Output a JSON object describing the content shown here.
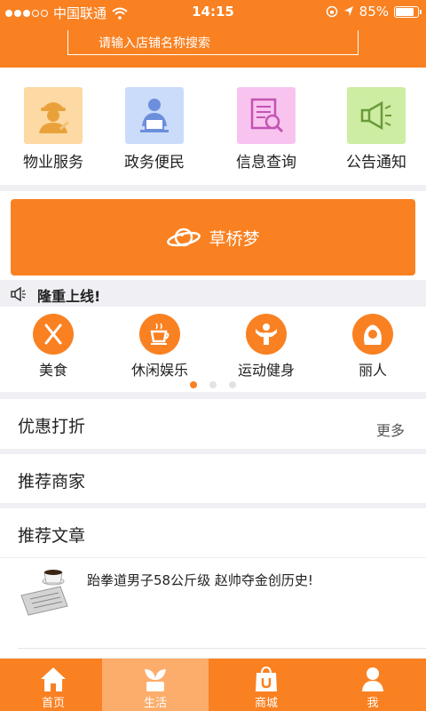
{
  "status_bar": {
    "carrier": "中国联通",
    "time": "14:15",
    "battery": "85%",
    "battery_level": 0.85
  },
  "search": {
    "placeholder": "请输入店铺名称搜索"
  },
  "categories": [
    {
      "label": "物业服务",
      "icon": "worker-icon",
      "bg": "#fdd9a3"
    },
    {
      "label": "政务便民",
      "icon": "person-at-desk-icon",
      "bg": "#cbdcfb"
    },
    {
      "label": "信息查询",
      "icon": "document-search-icon",
      "bg": "#f8c4ef"
    },
    {
      "label": "公告通知",
      "icon": "megaphone-icon",
      "bg": "#cdeda2"
    }
  ],
  "banner": {
    "label": "草桥梦",
    "icon": "planet-icon"
  },
  "notice": {
    "text": "隆重上线!",
    "icon": "speaker-icon"
  },
  "services": [
    {
      "label": "美食",
      "icon": "fork-knife-icon"
    },
    {
      "label": "休闲娱乐",
      "icon": "coffee-cup-icon"
    },
    {
      "label": "运动健身",
      "icon": "fitness-icon"
    },
    {
      "label": "丽人",
      "icon": "woman-icon"
    }
  ],
  "sections": {
    "discount": {
      "title": "优惠打折",
      "more": "更多"
    },
    "merchants": {
      "title": "推荐商家"
    },
    "articles": {
      "title": "推荐文章"
    }
  },
  "articles": [
    {
      "title": "跆拳道男子58公斤级 赵帅夺金创历史!",
      "icon": "newspaper-coffee-icon"
    }
  ],
  "tabbar": [
    {
      "label": "首页",
      "icon": "home-icon",
      "active": false
    },
    {
      "label": "生活",
      "icon": "plant-icon",
      "active": true
    },
    {
      "label": "商城",
      "icon": "shopping-bag-icon",
      "active": false
    },
    {
      "label": "我",
      "icon": "user-icon",
      "active": false
    }
  ],
  "colors": {
    "accent": "#f98122",
    "tab_active": "#fcad6b",
    "background": "#efeff4"
  }
}
